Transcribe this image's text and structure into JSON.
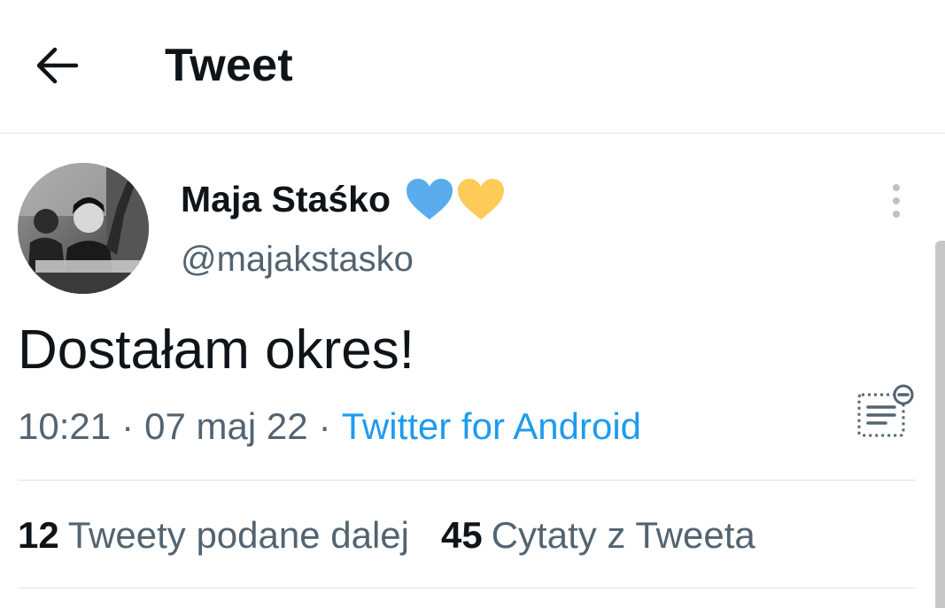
{
  "header": {
    "title": "Tweet",
    "back_icon": "arrow-left-icon"
  },
  "author": {
    "name": "Maja Staśko",
    "handle": "@majakstasko",
    "badges": [
      {
        "icon": "blue-heart-icon",
        "color": "#5aacec"
      },
      {
        "icon": "yellow-heart-icon",
        "color": "#fdcb58"
      }
    ]
  },
  "tweet": {
    "text": "Dostałam okres!",
    "time": "10:21",
    "date": "07 maj 22",
    "separator": "·",
    "source": "Twitter for Android"
  },
  "stats": {
    "retweets": {
      "count": "12",
      "label": "Tweety podane dalej"
    },
    "quotes": {
      "count": "45",
      "label": "Cytaty z Tweeta"
    }
  },
  "colors": {
    "link": "#1d9bf0",
    "secondary_text": "#536471",
    "primary_text": "#0f1419",
    "divider": "#dfe3e6"
  }
}
